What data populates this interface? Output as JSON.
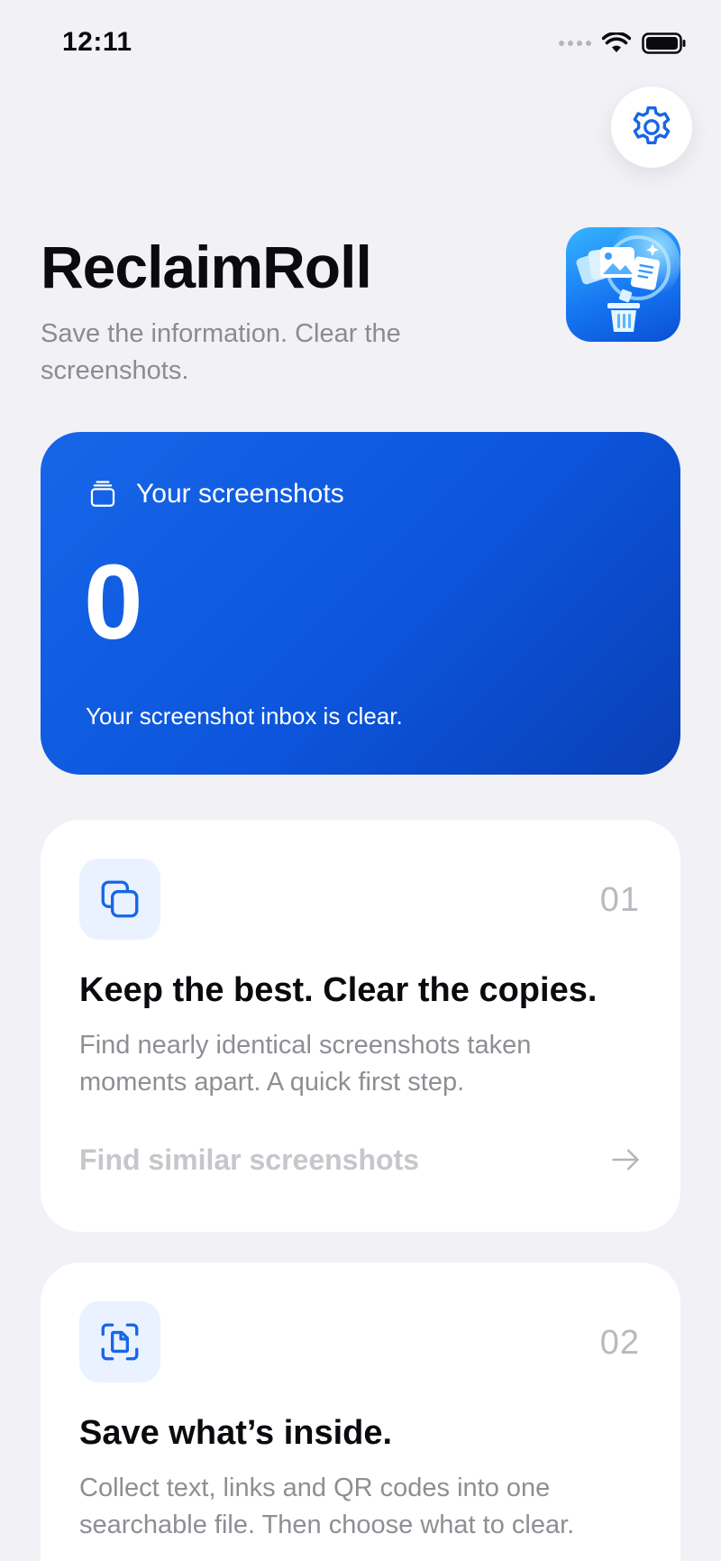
{
  "status_bar": {
    "time": "12:11",
    "icons": [
      "signal-icon",
      "wifi-icon",
      "battery-icon"
    ]
  },
  "header": {
    "title": "ReclaimRoll",
    "subtitle": "Save the information. Clear the screenshots.",
    "settings_icon": "gear-icon",
    "app_icon": "reclaimroll-app-icon"
  },
  "hero": {
    "label": "Your screenshots",
    "icon": "stack-icon",
    "count": "0",
    "note": "Your screenshot inbox is clear."
  },
  "cards": [
    {
      "number": "01",
      "icon": "copies-icon",
      "title": "Keep the best. Clear the copies.",
      "description": "Find nearly identical screenshots taken moments apart. A quick first step.",
      "action_label": "Find similar screenshots",
      "action_icon": "arrow-right-icon"
    },
    {
      "number": "02",
      "icon": "scan-document-icon",
      "title": "Save what’s inside.",
      "description": "Collect text, links and QR codes into one searchable file. Then choose what to clear."
    }
  ],
  "colors": {
    "background": "#F1F1F6",
    "accent": "#1766E8",
    "card": "#FFFFFF",
    "muted_text": "#8E8E94"
  }
}
